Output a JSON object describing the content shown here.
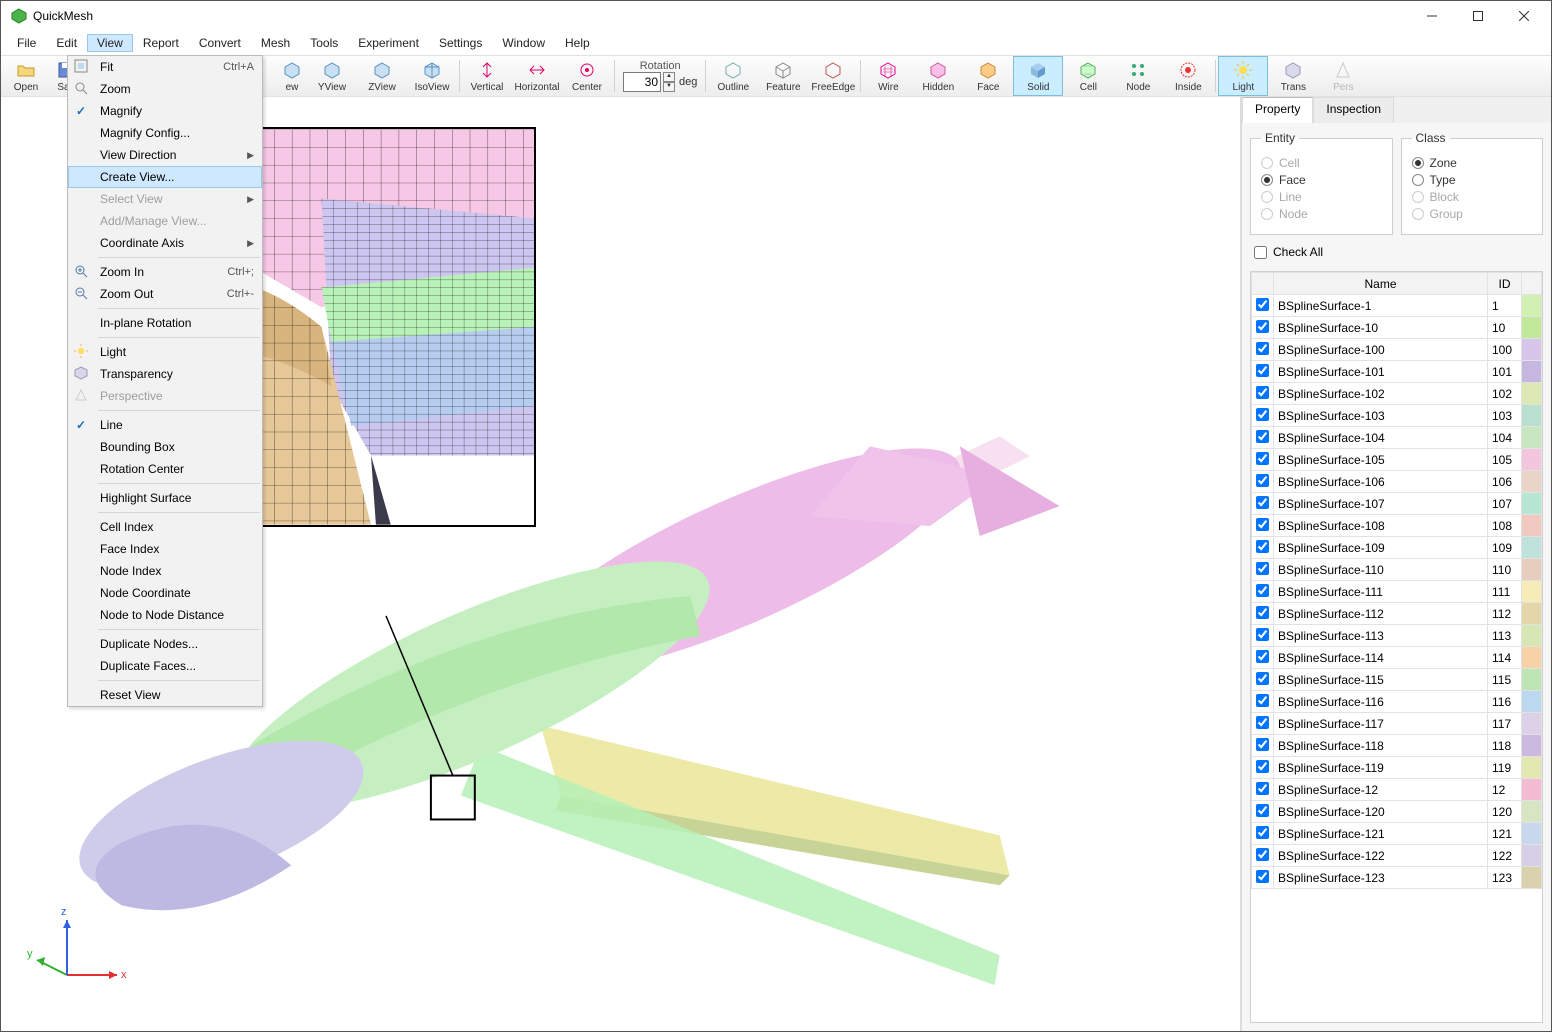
{
  "app": {
    "title": "QuickMesh"
  },
  "menubar": [
    "File",
    "Edit",
    "View",
    "Report",
    "Convert",
    "Mesh",
    "Tools",
    "Experiment",
    "Settings",
    "Window",
    "Help"
  ],
  "menubar_active": "View",
  "toolbar": {
    "open": "Open",
    "save": "Sav",
    "_hidden_prefix": "ew",
    "xview": "XView",
    "yview": "YView",
    "zview": "ZView",
    "isoview": "IsoView",
    "vertical": "Vertical",
    "horizontal": "Horizontal",
    "center": "Center",
    "rotation_label": "Rotation",
    "rotation_value": "30",
    "rotation_unit": "deg",
    "outline": "Outline",
    "feature": "Feature",
    "freeedge": "FreeEdge",
    "wire": "Wire",
    "hidden": "Hidden",
    "face": "Face",
    "solid": "Solid",
    "cell": "Cell",
    "node": "Node",
    "inside": "Inside",
    "light": "Light",
    "trans": "Trans",
    "pers": "Pers"
  },
  "view_menu": [
    {
      "label": "Fit",
      "shortcut": "Ctrl+A",
      "icon": "fit"
    },
    {
      "label": "Zoom",
      "icon": "zoom"
    },
    {
      "label": "Magnify",
      "checked": true
    },
    {
      "label": "Magnify Config..."
    },
    {
      "label": "View Direction",
      "submenu": true
    },
    {
      "label": "Create View...",
      "highlight": true
    },
    {
      "label": "Select View",
      "submenu": true,
      "disabled": true
    },
    {
      "label": "Add/Manage View...",
      "disabled": true
    },
    {
      "label": "Coordinate Axis",
      "submenu": true
    },
    {
      "sep": true
    },
    {
      "label": "Zoom In",
      "shortcut": "Ctrl+;",
      "icon": "zoomin"
    },
    {
      "label": "Zoom Out",
      "shortcut": "Ctrl+-",
      "icon": "zoomout"
    },
    {
      "sep": true
    },
    {
      "label": "In-plane Rotation"
    },
    {
      "sep": true
    },
    {
      "label": "Light",
      "icon": "light"
    },
    {
      "label": "Transparency",
      "icon": "trans"
    },
    {
      "label": "Perspective",
      "disabled": true,
      "icon": "pers"
    },
    {
      "sep": true
    },
    {
      "label": "Line",
      "checked": true
    },
    {
      "label": "Bounding Box"
    },
    {
      "label": "Rotation Center"
    },
    {
      "sep": true
    },
    {
      "label": "Highlight Surface"
    },
    {
      "sep": true
    },
    {
      "label": "Cell Index"
    },
    {
      "label": "Face Index"
    },
    {
      "label": "Node Index"
    },
    {
      "label": "Node Coordinate"
    },
    {
      "label": "Node to Node Distance"
    },
    {
      "sep": true
    },
    {
      "label": "Duplicate Nodes..."
    },
    {
      "label": "Duplicate Faces..."
    },
    {
      "sep": true
    },
    {
      "label": "Reset View"
    }
  ],
  "side": {
    "tabs": [
      "Property",
      "Inspection"
    ],
    "active_tab": "Property",
    "entity_label": "Entity",
    "class_label": "Class",
    "entity": [
      {
        "label": "Cell",
        "checked": false,
        "disabled": true
      },
      {
        "label": "Face",
        "checked": true,
        "disabled": false
      },
      {
        "label": "Line",
        "checked": false,
        "disabled": true
      },
      {
        "label": "Node",
        "checked": false,
        "disabled": true
      }
    ],
    "klass": [
      {
        "label": "Zone",
        "checked": true,
        "disabled": false
      },
      {
        "label": "Type",
        "checked": false,
        "disabled": false
      },
      {
        "label": "Block",
        "checked": false,
        "disabled": true
      },
      {
        "label": "Group",
        "checked": false,
        "disabled": true
      }
    ],
    "check_all": "Check All",
    "columns": {
      "name": "Name",
      "id": "ID"
    },
    "rows": [
      {
        "name": "BSplineSurface-1",
        "id": "1",
        "color": "#d1f0b1"
      },
      {
        "name": "BSplineSurface-10",
        "id": "10",
        "color": "#c2e89a"
      },
      {
        "name": "BSplineSurface-100",
        "id": "100",
        "color": "#d8c6ea"
      },
      {
        "name": "BSplineSurface-101",
        "id": "101",
        "color": "#c6b7e0"
      },
      {
        "name": "BSplineSurface-102",
        "id": "102",
        "color": "#dce9b4"
      },
      {
        "name": "BSplineSurface-103",
        "id": "103",
        "color": "#b9dfcf"
      },
      {
        "name": "BSplineSurface-104",
        "id": "104",
        "color": "#c8e6c0"
      },
      {
        "name": "BSplineSurface-105",
        "id": "105",
        "color": "#f4c6dd"
      },
      {
        "name": "BSplineSurface-106",
        "id": "106",
        "color": "#e9d4c8"
      },
      {
        "name": "BSplineSurface-107",
        "id": "107",
        "color": "#b6e7d2"
      },
      {
        "name": "BSplineSurface-108",
        "id": "108",
        "color": "#f2c9c0"
      },
      {
        "name": "BSplineSurface-109",
        "id": "109",
        "color": "#bfe3db"
      },
      {
        "name": "BSplineSurface-110",
        "id": "110",
        "color": "#e7cdbd"
      },
      {
        "name": "BSplineSurface-111",
        "id": "111",
        "color": "#f5edb5"
      },
      {
        "name": "BSplineSurface-112",
        "id": "112",
        "color": "#e3d6a9"
      },
      {
        "name": "BSplineSurface-113",
        "id": "113",
        "color": "#d7e7b4"
      },
      {
        "name": "BSplineSurface-114",
        "id": "114",
        "color": "#f6d2a6"
      },
      {
        "name": "BSplineSurface-115",
        "id": "115",
        "color": "#bee6b5"
      },
      {
        "name": "BSplineSurface-116",
        "id": "116",
        "color": "#bcd8ef"
      },
      {
        "name": "BSplineSurface-117",
        "id": "117",
        "color": "#dcd1e7"
      },
      {
        "name": "BSplineSurface-118",
        "id": "118",
        "color": "#cbb9e0"
      },
      {
        "name": "BSplineSurface-119",
        "id": "119",
        "color": "#e3e7b0"
      },
      {
        "name": "BSplineSurface-12",
        "id": "12",
        "color": "#f3bcd2"
      },
      {
        "name": "BSplineSurface-120",
        "id": "120",
        "color": "#d7e5c2"
      },
      {
        "name": "BSplineSurface-121",
        "id": "121",
        "color": "#c9d8ee"
      },
      {
        "name": "BSplineSurface-122",
        "id": "122",
        "color": "#d6cfe6"
      },
      {
        "name": "BSplineSurface-123",
        "id": "123",
        "color": "#d9d2ad"
      }
    ]
  },
  "axes": {
    "x": "x",
    "y": "y",
    "z": "z"
  }
}
